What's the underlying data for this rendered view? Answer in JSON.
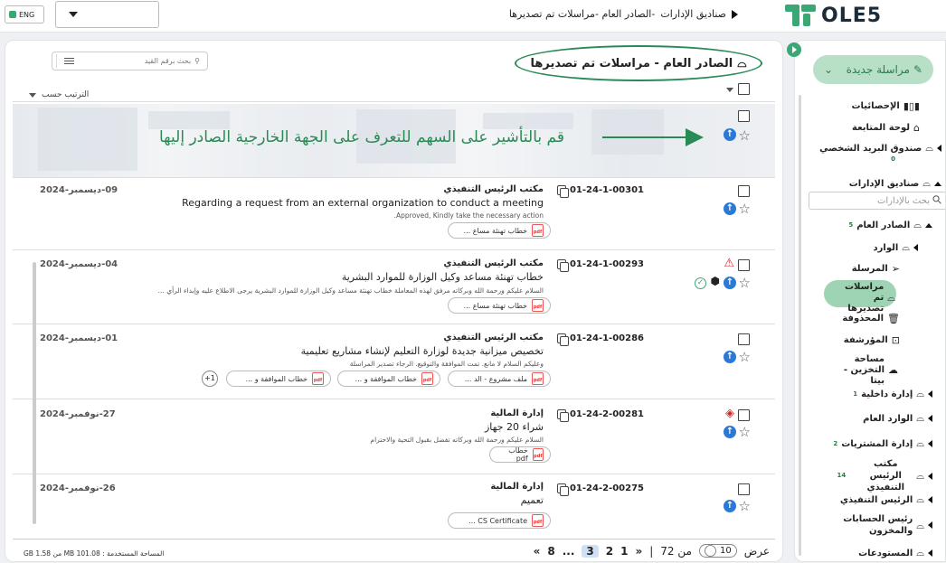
{
  "topbar": {
    "lang": "ENG",
    "breadcrumb": [
      "صناديق الإدارات",
      "-الصادر العام -مراسلات تم تصديرها"
    ],
    "logo_text": "OLE5",
    "brand_color": "#3aa774"
  },
  "main": {
    "title": "الصادر العام - مراسلات تم تصديرها",
    "search_placeholder": "بحث برقم القيد",
    "sort_label": "الترتيب حسب",
    "instruction": "قم بالتأشير على السهم للتعرف على الجهة الخارجية الصادر إليها",
    "rows": [
      {
        "ref": "01-24-1-00301",
        "sender": "مكتب الرئيس التنفيذي",
        "subject": "Regarding a request from an external organization to conduct a meeting",
        "snippet": "Approved, Kindly take the necessary action.",
        "date": "09-ديسمبر-2024",
        "attachments": [
          "خطاب تهنئة مساع ..."
        ]
      },
      {
        "ref": "01-24-1-00293",
        "sender": "مكتب الرئيس التنفيذي",
        "subject": "خطاب تهنئة مساعد وكيل الوزارة للموارد البشرية",
        "snippet": "السلام عليكم ورحمة الله وبركاته مرفق لهذه المعاملة خطاب تهنئة مساعد وكيل الوزارة للموارد البشرية يرجى الاطلاع عليه وإبداء الرأي ...",
        "date": "04-ديسمبر-2024",
        "attachments": [
          "خطاب تهنئة مساع ..."
        ]
      },
      {
        "ref": "01-24-1-00286",
        "sender": "مكتب الرئيس التنفيذي",
        "subject": "تخصيص ميزانية جديدة لوزارة التعليم لإنشاء مشاريع تعليمية",
        "snippet": "وعليكم السلام لا مانع. تمت الموافقة والتوقيع. الرجاء تصدير المراسلة",
        "date": "01-ديسمبر-2024",
        "attachments": [
          "ملف مشروع - الد ...",
          "خطاب الموافقة و ...",
          "خطاب الموافقة و ..."
        ],
        "more": "+1"
      },
      {
        "ref": "01-24-2-00281",
        "sender": "إدارة المالية",
        "subject": "شراء 20 جهاز",
        "snippet": "السلام عليكم ورحمة الله وبركاته تفضل بقبول التحية والاحترام",
        "date": "27-نوفمبر-2024",
        "attachments": [
          "خطاب pdf"
        ]
      },
      {
        "ref": "01-24-2-00275",
        "sender": "إدارة المالية",
        "subject": "تعميم",
        "snippet": "",
        "date": "26-نوفمبر-2024",
        "attachments": [
          "CS Certificate ..."
        ]
      }
    ]
  },
  "footer": {
    "storage": "المساحة المستخدمة : 101.08 MB من 1.58 GB",
    "show_label": "عرض",
    "page_size": "10",
    "of_label": "من 72",
    "pages": [
      "1",
      "2",
      "3",
      "...",
      "8"
    ],
    "current_page": "3",
    "prev": "«",
    "next": "»"
  },
  "sidebar": {
    "new_button": "مراسلة جديدة",
    "search_placeholder": "بحث بالإدارات",
    "items": [
      {
        "label": "الإحصائيات",
        "icon": "chart-icon"
      },
      {
        "label": "لوحة المتابعة",
        "icon": "dashboard-icon"
      },
      {
        "label": "صندوق البريد الشخصي",
        "count": "0"
      },
      {
        "label": "صناديق الإدارات"
      },
      {
        "label": "الصادر العام",
        "count": "5"
      },
      {
        "label": "الوارد"
      },
      {
        "label": "المرسلة"
      },
      {
        "label": "مراسلات تم تصديرها"
      },
      {
        "label": "المحذوفة"
      },
      {
        "label": "المؤرشفة"
      },
      {
        "label": "مساحة التخزين - بيتا"
      },
      {
        "label": "إدارة داخلية",
        "count": "1"
      },
      {
        "label": "الوارد العام"
      },
      {
        "label": "إدارة المشتريات",
        "count": "2"
      },
      {
        "label": "مكتب الرئيس التنفيذي",
        "count": "14"
      },
      {
        "label": "الرئيس التنفيذي"
      },
      {
        "label": "رئيس الحسابات والمخزون"
      },
      {
        "label": "المستودعات"
      }
    ]
  }
}
